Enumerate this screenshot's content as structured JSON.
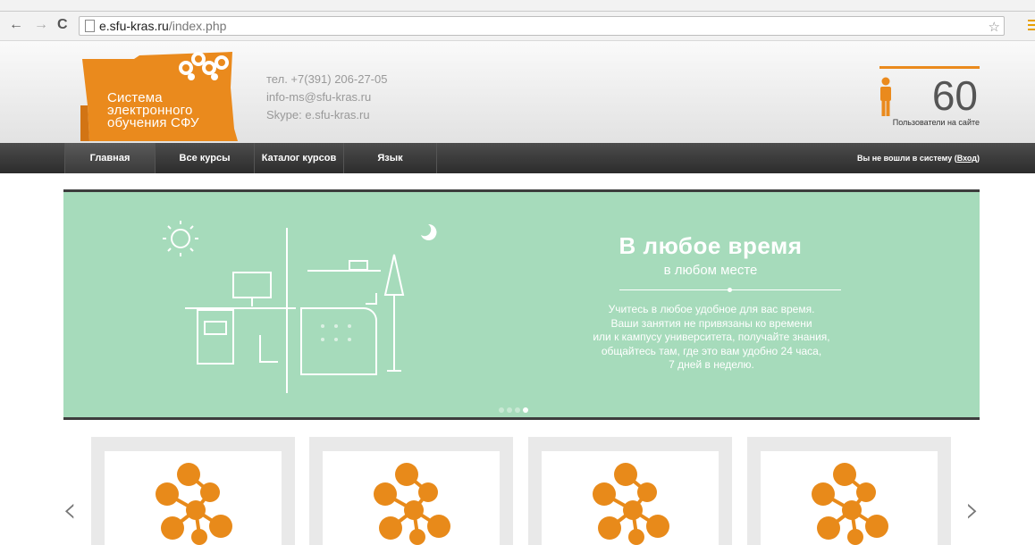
{
  "browser": {
    "back": "←",
    "forward": "→",
    "reload": "C",
    "url_host": "e.sfu-kras.ru",
    "url_path": "/index.php",
    "bookmark": "☆"
  },
  "header": {
    "logo_lines": [
      "Система",
      "электронного",
      "обучения СФУ"
    ],
    "phone": "тел. +7(391) 206-27-05",
    "email": "info-ms@sfu-kras.ru",
    "skype": "Skype: e.sfu-kras.ru",
    "users_count": "60",
    "users_label": "Пользователи на сайте"
  },
  "nav": {
    "items": [
      {
        "label": "Главная"
      },
      {
        "label": "Все курсы"
      },
      {
        "label": "Каталог курсов"
      },
      {
        "label": "Язык"
      }
    ],
    "login_text": "Вы не вошли в систему (",
    "login_link": "Вход",
    "login_close": ")"
  },
  "banner": {
    "title": "В любое время",
    "subtitle": "в любом месте",
    "text_lines": [
      "Учитесь в любое удобное для вас время.",
      "Ваши занятия не привязаны ко времени",
      "или к кампусу университета, получайте знания,",
      "общайтесь там, где это вам удобно 24 часа,",
      "7 дней в неделю."
    ],
    "slides": 4,
    "active_slide": 4
  },
  "carousel": {
    "prev": "‹",
    "next": "›",
    "cards": 4
  },
  "colors": {
    "accent": "#ea8a1d",
    "banner_bg": "#a6dbbb",
    "nav_bg": "#3a3a3a"
  }
}
